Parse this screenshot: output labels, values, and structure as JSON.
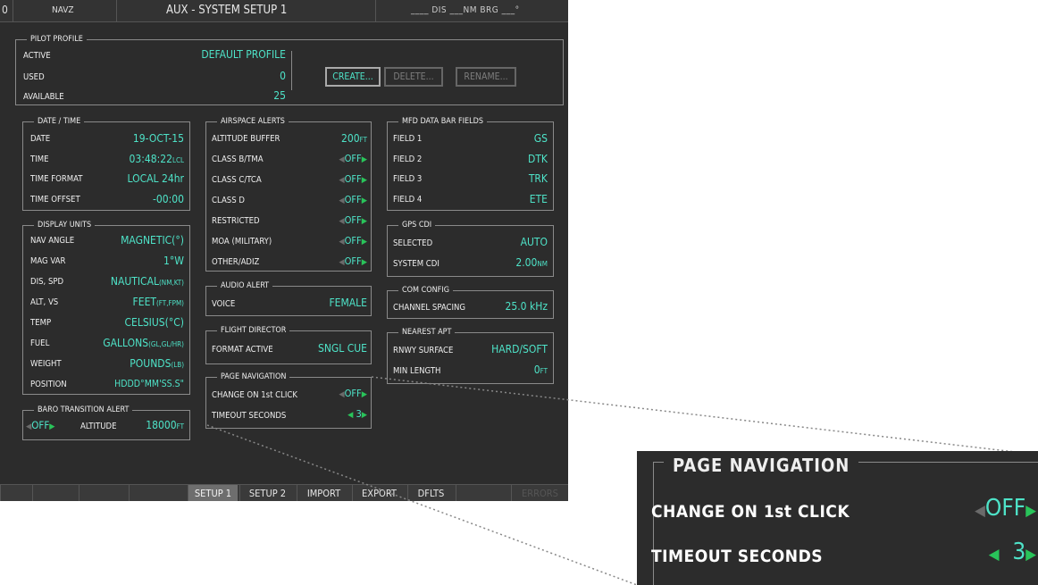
{
  "topbar": {
    "left_num": "0",
    "navz": "NAVZ",
    "title": "AUX - SYSTEM SETUP 1",
    "dis_brg": "____ DIS ___NM  BRG ___°"
  },
  "pilot_profile": {
    "title": "PILOT PROFILE",
    "active_label": "ACTIVE",
    "active_value": "DEFAULT PROFILE",
    "used_label": "USED",
    "used_value": "0",
    "available_label": "AVAILABLE",
    "available_value": "25",
    "create": "CREATE...",
    "delete": "DELETE...",
    "rename": "RENAME..."
  },
  "date_time": {
    "title": "DATE / TIME",
    "date_label": "DATE",
    "date_value": "19-OCT-15",
    "time_label": "TIME",
    "time_value": "03:48:22",
    "time_unit": "LCL",
    "format_label": "TIME FORMAT",
    "format_value": "LOCAL 24hr",
    "offset_label": "TIME OFFSET",
    "offset_value": "-00:00"
  },
  "display_units": {
    "title": "DISPLAY UNITS",
    "rows": [
      {
        "label": "NAV ANGLE",
        "value": "MAGNETIC(°)"
      },
      {
        "label": "MAG VAR",
        "value": "1°W"
      },
      {
        "label": "DIS, SPD",
        "value": "NAUTICAL",
        "unit": "(NM,KT)"
      },
      {
        "label": "ALT, VS",
        "value": "FEET",
        "unit": "(FT,FPM)"
      },
      {
        "label": "TEMP",
        "value": "CELSIUS(°C)"
      },
      {
        "label": "FUEL",
        "value": "GALLONS",
        "unit": "(GL,GL/HR)"
      },
      {
        "label": "WEIGHT",
        "value": "POUNDS",
        "unit": "(LB)"
      },
      {
        "label": "POSITION",
        "value": "HDDD°MM'SS.S\""
      }
    ]
  },
  "baro": {
    "title": "BARO TRANSITION ALERT",
    "state": "OFF",
    "alt_label": "ALTITUDE",
    "alt_value": "18000",
    "alt_unit": "FT"
  },
  "airspace": {
    "title": "AIRSPACE ALERTS",
    "buffer_label": "ALTITUDE BUFFER",
    "buffer_value": "200",
    "buffer_unit": "FT",
    "rows": [
      {
        "label": "CLASS B/TMA",
        "value": "OFF"
      },
      {
        "label": "CLASS C/TCA",
        "value": "OFF"
      },
      {
        "label": "CLASS D",
        "value": "OFF"
      },
      {
        "label": "RESTRICTED",
        "value": "OFF"
      },
      {
        "label": "MOA (MILITARY)",
        "value": "OFF"
      },
      {
        "label": "OTHER/ADIZ",
        "value": "OFF"
      }
    ]
  },
  "audio": {
    "title": "AUDIO ALERT",
    "label": "VOICE",
    "value": "FEMALE"
  },
  "flight_director": {
    "title": "FLIGHT DIRECTOR",
    "label": "FORMAT ACTIVE",
    "value": "SNGL CUE"
  },
  "page_nav": {
    "title": "PAGE NAVIGATION",
    "click_label": "CHANGE ON 1st CLICK",
    "click_value": "OFF",
    "timeout_label": "TIMEOUT SECONDS",
    "timeout_value": "3"
  },
  "mfd_fields": {
    "title": "MFD DATA BAR FIELDS",
    "rows": [
      {
        "label": "FIELD 1",
        "value": "GS"
      },
      {
        "label": "FIELD 2",
        "value": "DTK"
      },
      {
        "label": "FIELD 3",
        "value": "TRK"
      },
      {
        "label": "FIELD 4",
        "value": "ETE"
      }
    ]
  },
  "gps_cdi": {
    "title": "GPS CDI",
    "selected_label": "SELECTED",
    "selected_value": "AUTO",
    "system_label": "SYSTEM CDI",
    "system_value": "2.00",
    "system_unit": "NM"
  },
  "com_config": {
    "title": "COM CONFIG",
    "label": "CHANNEL SPACING",
    "value": "25.0 kHz"
  },
  "nearest_apt": {
    "title": "NEAREST APT",
    "surface_label": "RNWY SURFACE",
    "surface_value": "HARD/SOFT",
    "length_label": "MIN LENGTH",
    "length_value": "0",
    "length_unit": "FT"
  },
  "softkeys": {
    "setup1": "SETUP 1",
    "setup2": "SETUP 2",
    "import": "IMPORT",
    "export": "EXPORT",
    "dflts": "DFLTS",
    "last": "ERRORS"
  },
  "callout": {
    "title": "PAGE NAVIGATION",
    "click_label": "CHANGE ON 1st CLICK",
    "click_value": "OFF",
    "timeout_label": "TIMEOUT SECONDS",
    "timeout_value": "3"
  }
}
